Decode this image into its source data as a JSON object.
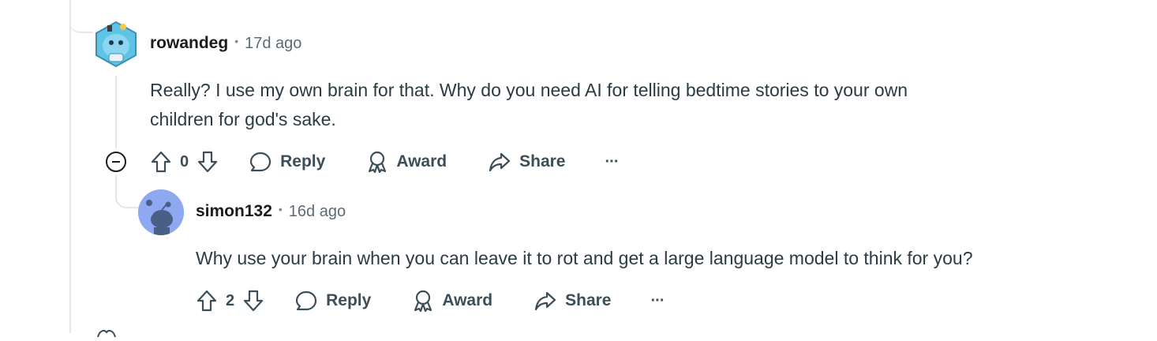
{
  "comments": [
    {
      "username": "rowandeg",
      "time": "17d ago",
      "text_line1": "Really? I use my own brain for that. Why do you need AI for telling bedtime stories to your own",
      "text_line2": "children for god's sake.",
      "votes": "0",
      "reply_label": "Reply",
      "award_label": "Award",
      "share_label": "Share",
      "more_label": "···"
    },
    {
      "username": "simon132",
      "time": "16d ago",
      "text_line1": "Why use your brain when you can leave it to rot and get a large language model to think for you?",
      "votes": "2",
      "reply_label": "Reply",
      "award_label": "Award",
      "share_label": "Share",
      "more_label": "···"
    }
  ],
  "colors": {
    "accent_avatar": "#8ea9f2",
    "snoo_avatar_bg": "#6fc6e6",
    "thread_line": "#e4e7ea"
  },
  "icons": [
    "upvote-icon",
    "downvote-icon",
    "reply-bubble-icon",
    "award-icon",
    "share-arrow-icon",
    "more-icon",
    "collapse-icon"
  ]
}
